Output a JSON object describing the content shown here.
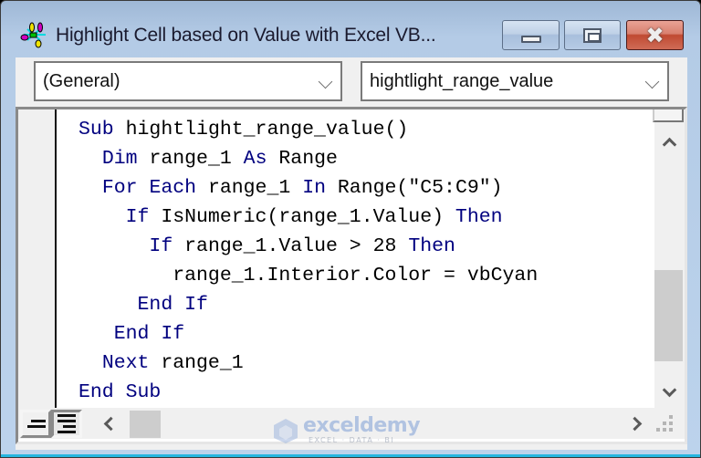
{
  "window": {
    "title": "Highlight Cell based on Value with Excel VB...",
    "icon": "vba-project-icon",
    "buttons": {
      "minimize": "minimize",
      "maximize": "restore",
      "close": "✖"
    }
  },
  "toolbar": {
    "object_combo": {
      "value": "(General)"
    },
    "procedure_combo": {
      "value": "hightlight_range_value"
    }
  },
  "code": {
    "language": "VBA",
    "lines": [
      "Sub hightlight_range_value()",
      "  Dim range_1 As Range",
      "  For Each range_1 In Range(\"C5:C9\")",
      "    If IsNumeric(range_1.Value) Then",
      "      If range_1.Value > 28 Then",
      "        range_1.Interior.Color = vbCyan",
      "     End If",
      "   End If",
      "  Next range_1",
      "End Sub"
    ],
    "keywords": [
      "Sub",
      "Dim",
      "As",
      "For",
      "Each",
      "In",
      "If",
      "Then",
      "End",
      "Next"
    ],
    "colors": {
      "keyword": "#00007f",
      "text": "#000000"
    }
  },
  "status": {
    "view_buttons": [
      "procedure-view",
      "full-module-view"
    ]
  },
  "watermark": {
    "name": "exceldemy",
    "tagline": "EXCEL · DATA · BI"
  }
}
